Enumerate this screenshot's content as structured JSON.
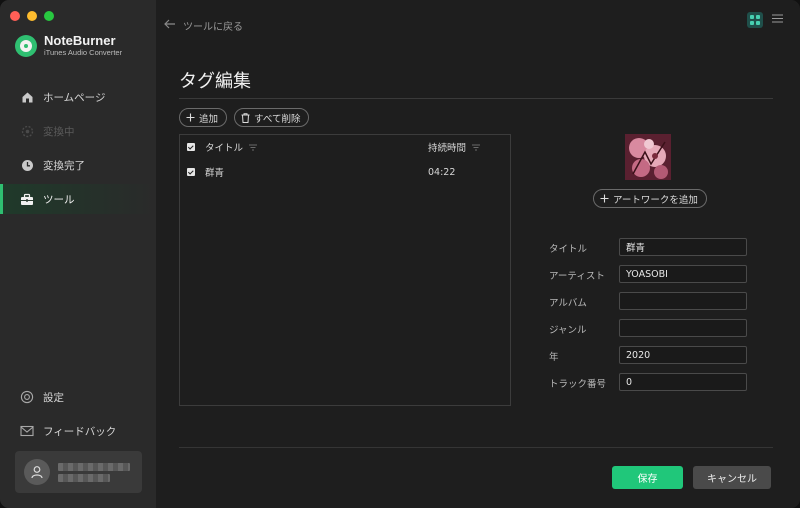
{
  "app": {
    "name": "NoteBurner",
    "subtitle": "iTunes Audio Converter",
    "accent": "#2fbf71"
  },
  "sidebar": {
    "items": [
      {
        "label": "ホームページ",
        "icon": "home-icon",
        "state": "normal"
      },
      {
        "label": "変換中",
        "icon": "converting-icon",
        "state": "disabled"
      },
      {
        "label": "変換完了",
        "icon": "clock-icon",
        "state": "normal"
      },
      {
        "label": "ツール",
        "icon": "toolbox-icon",
        "state": "active"
      }
    ],
    "bottom": [
      {
        "label": "設定",
        "icon": "gear-icon"
      },
      {
        "label": "フィードバック",
        "icon": "mail-icon"
      }
    ]
  },
  "header": {
    "back_label": "ツールに戻る"
  },
  "page": {
    "title": "タグ編集",
    "add_label": "追加",
    "delete_all_label": "すべて削除"
  },
  "table": {
    "columns": [
      "タイトル",
      "持続時間"
    ],
    "rows": [
      {
        "title": "群青",
        "duration": "04:22",
        "checked": true
      }
    ]
  },
  "artwork": {
    "add_label": "アートワークを追加"
  },
  "fields": [
    {
      "label": "タイトル",
      "value": "群青"
    },
    {
      "label": "アーティスト",
      "value": "YOASOBI"
    },
    {
      "label": "アルバム",
      "value": ""
    },
    {
      "label": "ジャンル",
      "value": ""
    },
    {
      "label": "年",
      "value": "2020"
    },
    {
      "label": "トラック番号",
      "value": "0"
    }
  ],
  "footer": {
    "save_label": "保存",
    "cancel_label": "キャンセル",
    "save_color": "#20c77a"
  }
}
